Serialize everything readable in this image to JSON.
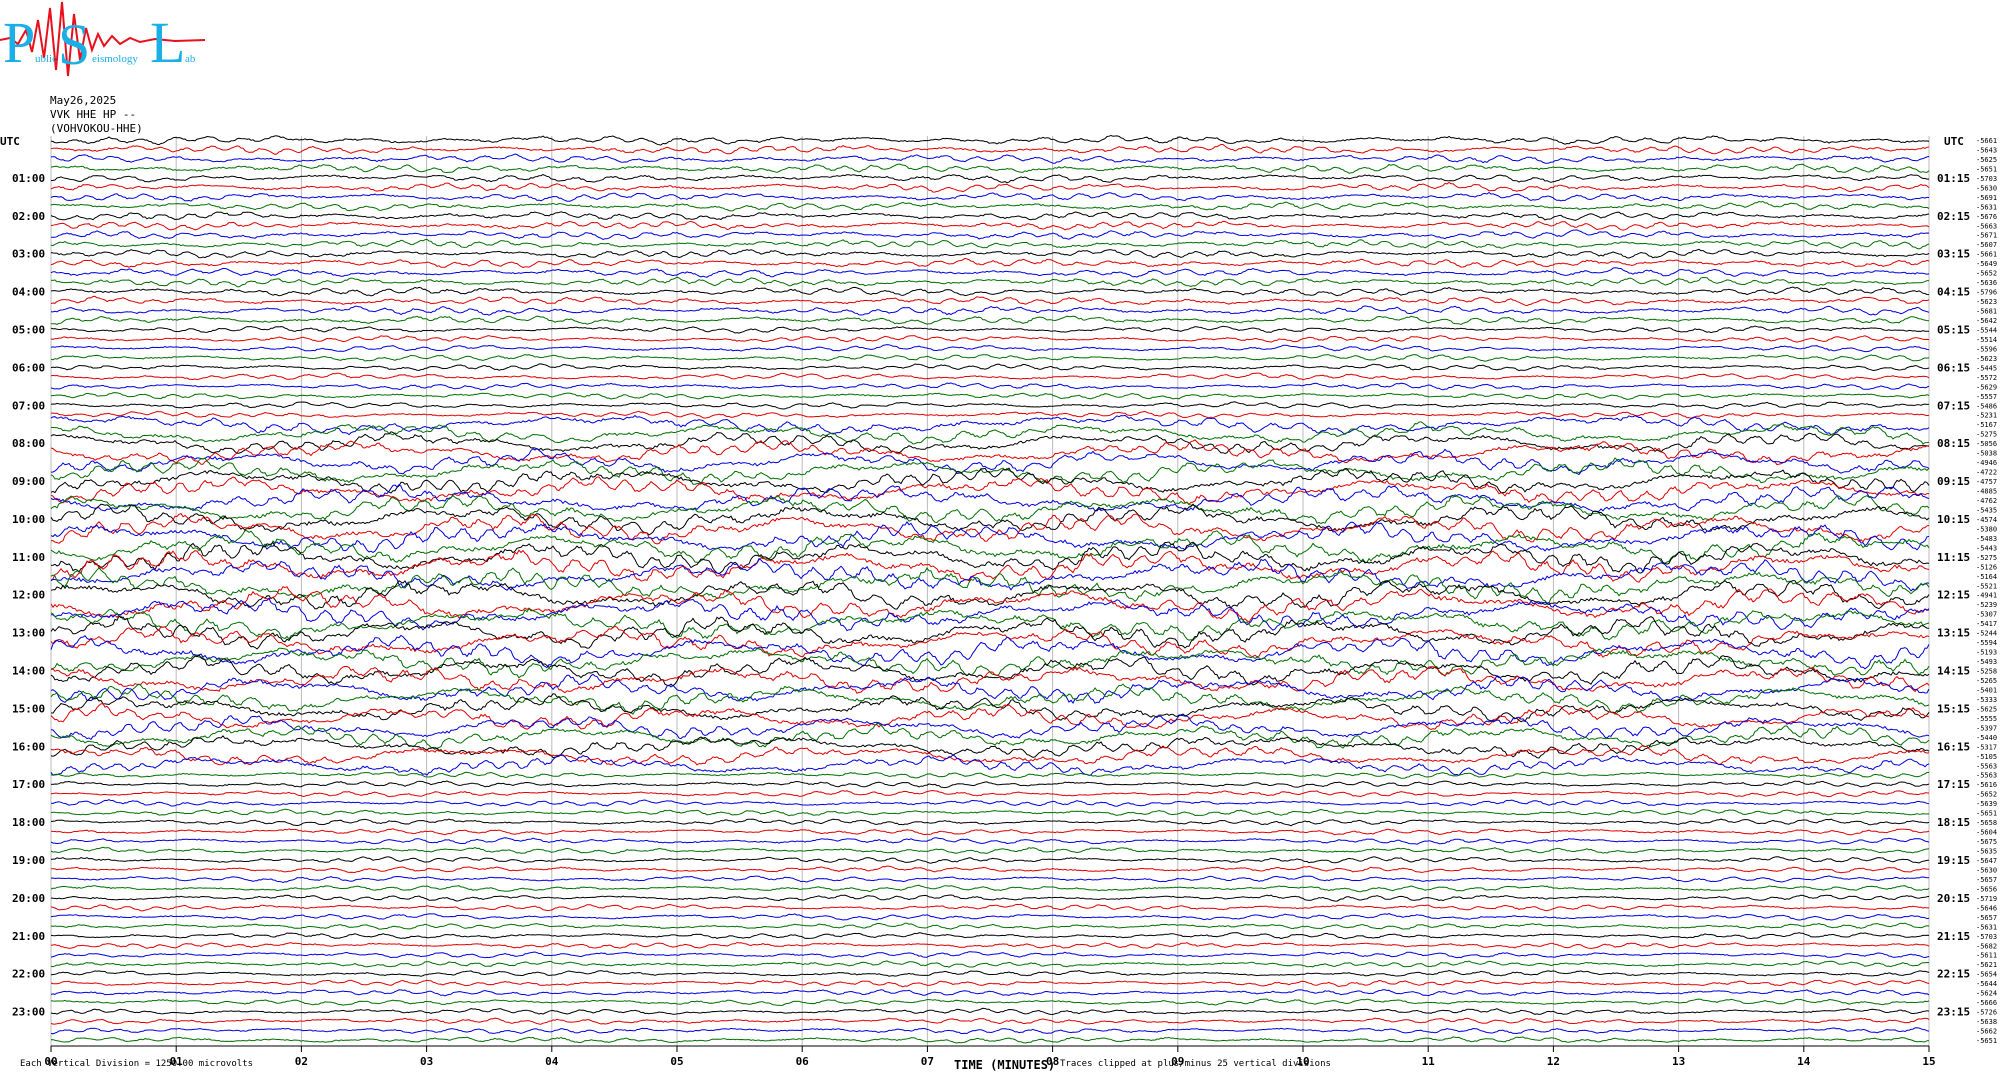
{
  "logo": {
    "letters": [
      "P",
      "S",
      "L"
    ],
    "small_text": [
      "ublic",
      "eismology",
      "ab"
    ],
    "colors": {
      "letters": "#1ab0e6",
      "signal": "#e8101c"
    }
  },
  "header": {
    "date": "May26,2025",
    "station": "VVK HHE HP --",
    "station_full": "(VOHVOKOU-HHE)"
  },
  "footer": {
    "scale_note": "Each Vertical Division = 1250.00 microvolts",
    "xaxis_title": "TIME (MINUTES)",
    "clip_note": "Traces clipped at plus/minus 25 vertical divisions"
  },
  "chart_data": {
    "type": "line",
    "title": "",
    "xlabel": "TIME (MINUTES)",
    "ylabel": "UTC",
    "xlim": [
      0,
      15
    ],
    "x_ticks": [
      "00",
      "01",
      "02",
      "03",
      "04",
      "05",
      "06",
      "07",
      "08",
      "09",
      "10",
      "11",
      "12",
      "13",
      "14",
      "15"
    ],
    "left_corner_label": "UTC",
    "right_corner_label": "UTC",
    "left_hour_labels": [
      "01:00",
      "02:00",
      "03:00",
      "04:00",
      "05:00",
      "06:00",
      "07:00",
      "08:00",
      "09:00",
      "10:00",
      "11:00",
      "12:00",
      "13:00",
      "14:00",
      "15:00",
      "16:00",
      "17:00",
      "18:00",
      "19:00",
      "20:00",
      "21:00",
      "22:00",
      "23:00"
    ],
    "right_hour_labels": [
      "01:15",
      "02:15",
      "03:15",
      "04:15",
      "05:15",
      "06:15",
      "07:15",
      "08:15",
      "09:15",
      "10:15",
      "11:15",
      "12:15",
      "13:15",
      "14:15",
      "15:15",
      "16:15",
      "17:15",
      "18:15",
      "19:15",
      "20:15",
      "21:15",
      "22:15",
      "23:15"
    ],
    "trace_colors": [
      "#000000",
      "#e00000",
      "#0000e0",
      "#007000"
    ],
    "trace_count": 96,
    "trace_offsets": [
      "-5661",
      "-5643",
      "-5625",
      "-5651",
      "-5703",
      "-5630",
      "-5691",
      "-5631",
      "-5676",
      "-5663",
      "-5671",
      "-5607",
      "-5661",
      "-5649",
      "-5652",
      "-5636",
      "-5796",
      "-5623",
      "-5681",
      "-5642",
      "-5544",
      "-5514",
      "-5596",
      "-5623",
      "-5445",
      "-5572",
      "-5629",
      "-5557",
      "-5486",
      "-5231",
      "-5167",
      "-5275",
      "-5056",
      "-5038",
      "-4946",
      "-4722",
      "-4757",
      "-4885",
      "-4762",
      "-5435",
      "-4574",
      "-5380",
      "-5483",
      "-5443",
      "-5275",
      "-5126",
      "-5164",
      "-5521",
      "-4941",
      "-5239",
      "-5307",
      "-5417",
      "-5244",
      "-5594",
      "-5193",
      "-5493",
      "-5258",
      "-5265",
      "-5401",
      "-5333",
      "-5625",
      "-5555",
      "-5397",
      "-5440",
      "-5317",
      "-5105",
      "-5563",
      "-5563",
      "-5616",
      "-5652",
      "-5639",
      "-5651",
      "-5658",
      "-5604",
      "-5675",
      "-5635",
      "-5647",
      "-5630",
      "-5657",
      "-5656",
      "-5719",
      "-5646",
      "-5657",
      "-5631",
      "-5703",
      "-5682",
      "-5611",
      "-5621",
      "-5654",
      "-5644",
      "-5624",
      "-5666",
      "-5726",
      "-5638",
      "-5662",
      "-5651"
    ]
  }
}
